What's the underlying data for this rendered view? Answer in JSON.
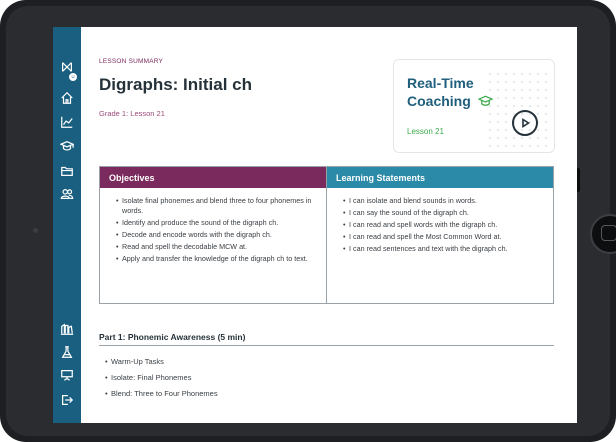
{
  "sidebar": {
    "icons": [
      "app-logo-icon",
      "home-icon",
      "progress-chart-icon",
      "graduation-cap-icon",
      "folder-icon",
      "users-icon",
      "library-icon",
      "lab-flask-icon",
      "presentation-icon",
      "logout-icon"
    ],
    "accent": "#1a5f7f"
  },
  "lesson": {
    "eyebrow": "LESSON SUMMARY",
    "title": "Digraphs: Initial ch",
    "grade": "Grade 1: Lesson 21"
  },
  "coaching_card": {
    "title": "Real-Time Coaching",
    "lesson": "Lesson 21",
    "icon": "graduation-cap-icon",
    "action_icon": "play-icon"
  },
  "table": {
    "headers": {
      "objectives": "Objectives",
      "learning_statements": "Learning Statements"
    },
    "objectives": [
      "Isolate final phonemes and blend three to four phonemes in words.",
      "Identify and produce the sound of the digraph ch.",
      "Decode and encode words with the digraph ch.",
      "Read and spell the decodable MCW at.",
      "Apply and transfer the knowledge of the digraph ch to text."
    ],
    "learning_statements": [
      "I can isolate and blend sounds in words.",
      "I can say the sound of the digraph ch.",
      "I can read and spell words with the digraph ch.",
      "I can read and spell the Most Common Word at.",
      "I can read sentences and text with the digraph ch."
    ],
    "colors": {
      "objectives_header": "#7a2a5c",
      "learning_header": "#2a8aa8"
    }
  },
  "part1": {
    "title": "Part 1: Phonemic Awareness (5 min)",
    "tasks": [
      "Warm-Up Tasks",
      "Isolate: Final Phonemes",
      "Blend: Three to Four Phonemes"
    ]
  }
}
